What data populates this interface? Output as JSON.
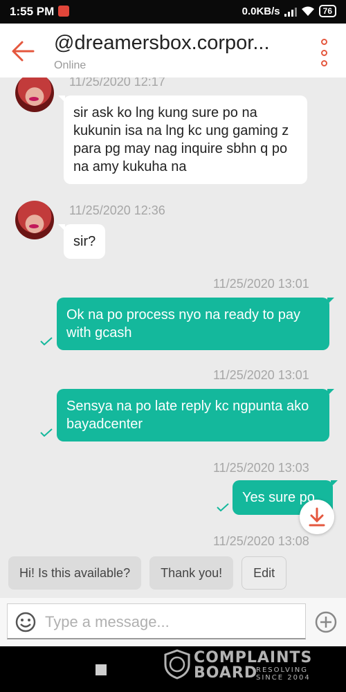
{
  "status_bar": {
    "time": "1:55 PM",
    "network_speed": "0.0KB/s",
    "battery": "76",
    "icons": [
      "notification-icon",
      "signal-icon",
      "wifi-icon",
      "battery-icon"
    ]
  },
  "header": {
    "title": "@dreamersbox.corpor...",
    "status": "Online",
    "accent_color": "#e4573e",
    "icons": [
      "back-arrow-icon",
      "more-vertical-icon"
    ]
  },
  "messages": [
    {
      "direction": "incoming",
      "timestamp": "11/25/2020 12:17",
      "text": "sir ask ko lng kung sure po na kukunin isa na lng kc ung gaming z para pg may nag inquire sbhn q po na amy kukuha na"
    },
    {
      "direction": "incoming",
      "timestamp": "11/25/2020 12:36",
      "text": "sir?"
    },
    {
      "direction": "outgoing",
      "timestamp": "11/25/2020 13:01",
      "text": "Ok na po process nyo na ready to pay with gcash",
      "read": true
    },
    {
      "direction": "outgoing",
      "timestamp": "11/25/2020 13:01",
      "text": "Sensya na po late reply kc ngpunta ako bayadcenter",
      "read": true
    },
    {
      "direction": "outgoing",
      "timestamp": "11/25/2020 13:03",
      "text": "Yes sure po",
      "read": true
    },
    {
      "direction": "outgoing",
      "timestamp": "11/25/2020 13:08",
      "text": ""
    }
  ],
  "quick_replies": [
    "Hi! Is this available?",
    "Thank you!",
    "Edit"
  ],
  "composer": {
    "placeholder": "Type a message...",
    "icons": [
      "emoji-icon",
      "add-icon"
    ]
  },
  "colors": {
    "outgoing_bubble": "#14b89c",
    "incoming_bubble": "#ffffff",
    "chat_background": "#ebebeb"
  },
  "watermark": {
    "line1": "COMPLAINTS",
    "line2": "BOARD",
    "tagline1": "RESOLVING",
    "tagline2": "SINCE 2004"
  }
}
